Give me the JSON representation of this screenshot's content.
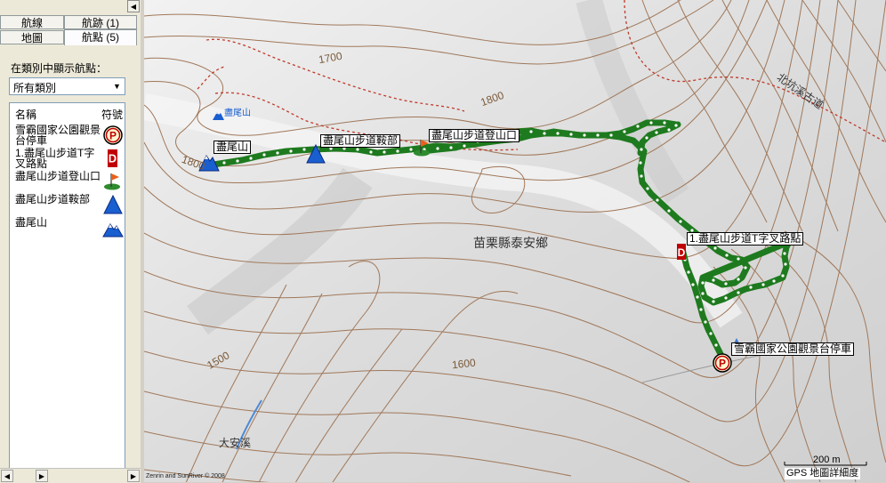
{
  "tabs": {
    "routes": "航線",
    "tracks": "航跡 (1)",
    "map": "地圖",
    "waypoints": "航點 (5)"
  },
  "category": {
    "label": "在類別中顯示航點：",
    "selected": "所有類別"
  },
  "waypoint_list": {
    "col_name": "名稱",
    "col_symbol": "符號",
    "items": [
      {
        "name": "雪霸國家公園觀景台停車",
        "symbol": "parking-icon"
      },
      {
        "name": "1.盡尾山步道T字叉路點",
        "symbol": "flag-d-icon"
      },
      {
        "name": "盡尾山步道登山口",
        "symbol": "trailhead-icon"
      },
      {
        "name": "盡尾山步道鞍部",
        "symbol": "blue-triangle-icon"
      },
      {
        "name": "盡尾山",
        "symbol": "summit-icon"
      }
    ]
  },
  "map": {
    "contour_labels": [
      "1700",
      "1800",
      "1800",
      "1500",
      "1600"
    ],
    "road_label": "北坑溪古道",
    "region_label": "苗栗縣泰安鄉",
    "stream_label": "大安溪",
    "peak_label": "盡尾山",
    "waypoint_labels": {
      "summit": "盡尾山",
      "saddle": "盡尾山步道鞍部",
      "trailhead": "盡尾山步道登山口",
      "junction": "1.盡尾山步道T字叉路點",
      "parking": "雪霸國家公園觀景台停車"
    },
    "scale": "200 m",
    "detail_label": "GPS 地圖詳細度",
    "copyright": "Zenrin and SunRiver © 2008",
    "colors": {
      "track": "#1e7a1e",
      "contour": "#a0785a",
      "trail": "#c0392b",
      "stream": "#4a8ad8"
    }
  }
}
